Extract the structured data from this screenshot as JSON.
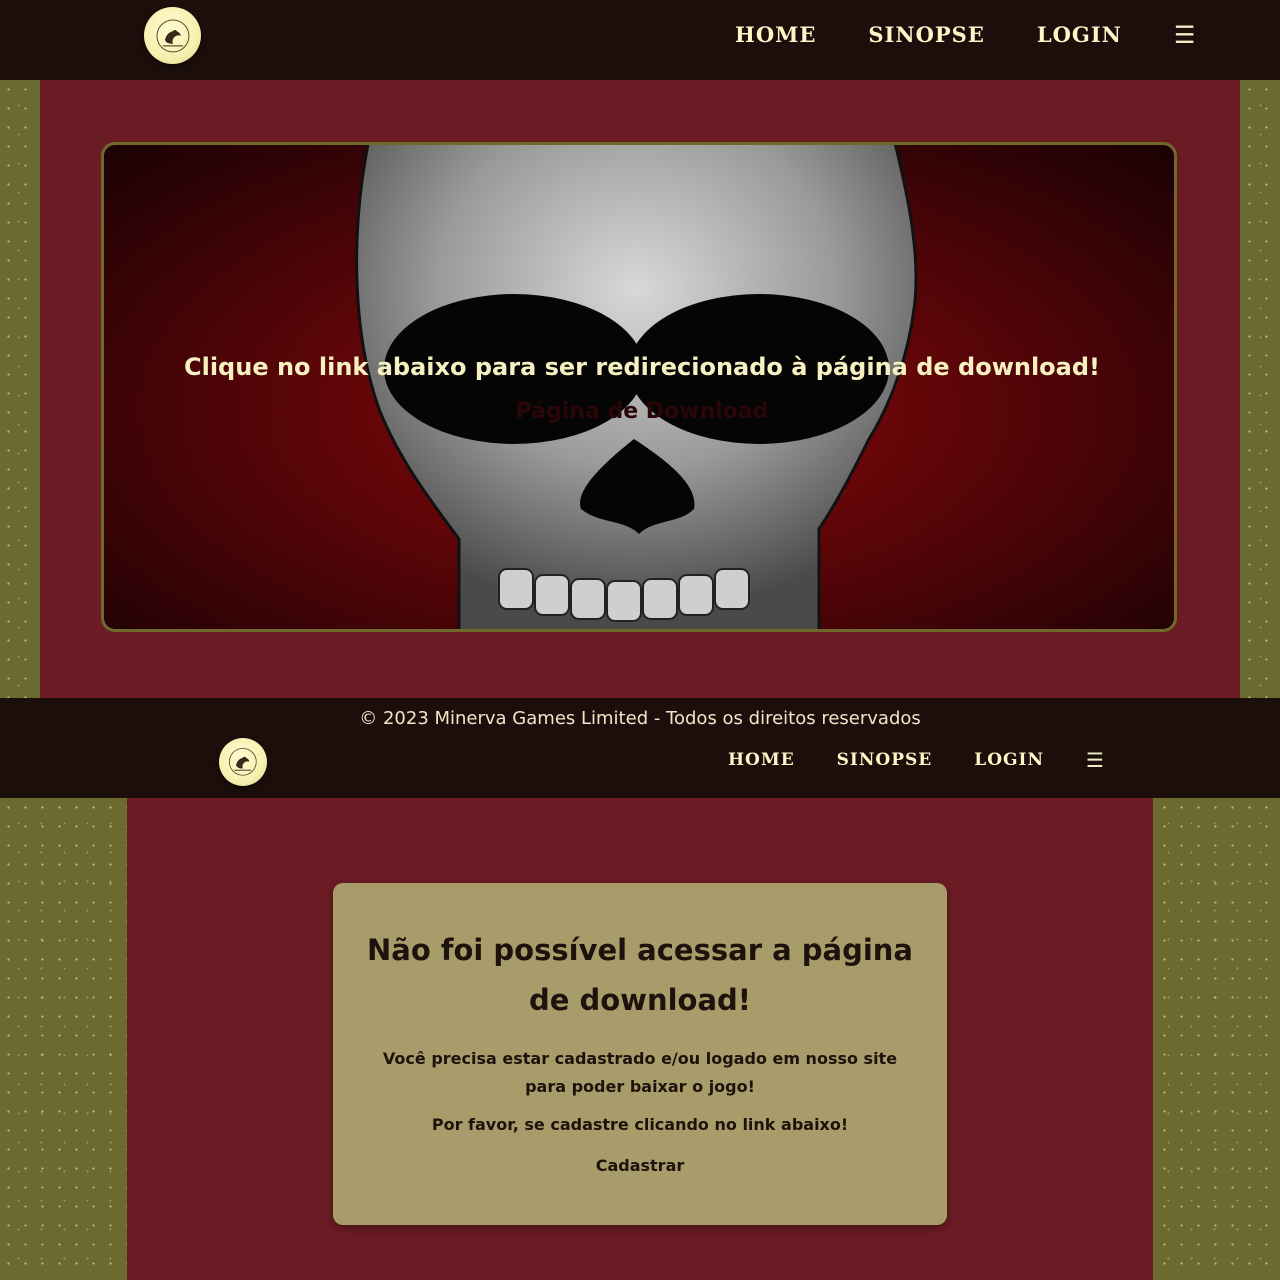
{
  "nav": {
    "home": "HOME",
    "sinopse": "SINOPSE",
    "login": "LOGIN",
    "menu_icon": "☰"
  },
  "hero": {
    "title": "Clique no link abaixo para ser redirecionado à página de download!",
    "link": "Página de Download"
  },
  "footer": {
    "copyright": "© 2023 Minerva Games Limited - Todos os direitos reservados"
  },
  "error_card": {
    "title": "Não foi possível acessar a página de download!",
    "message": "Você precisa estar cadastrado e/ou logado em nosso site para poder baixar o jogo!",
    "instruction": "Por favor, se cadastre clicando no link abaixo!",
    "link": "Cadastrar"
  },
  "colors": {
    "navbar": "#1c0f0b",
    "maroon": "#6a1b24",
    "olive": "#6b6a30",
    "card": "#a89c6a",
    "nav_text": "#fff6c8"
  }
}
